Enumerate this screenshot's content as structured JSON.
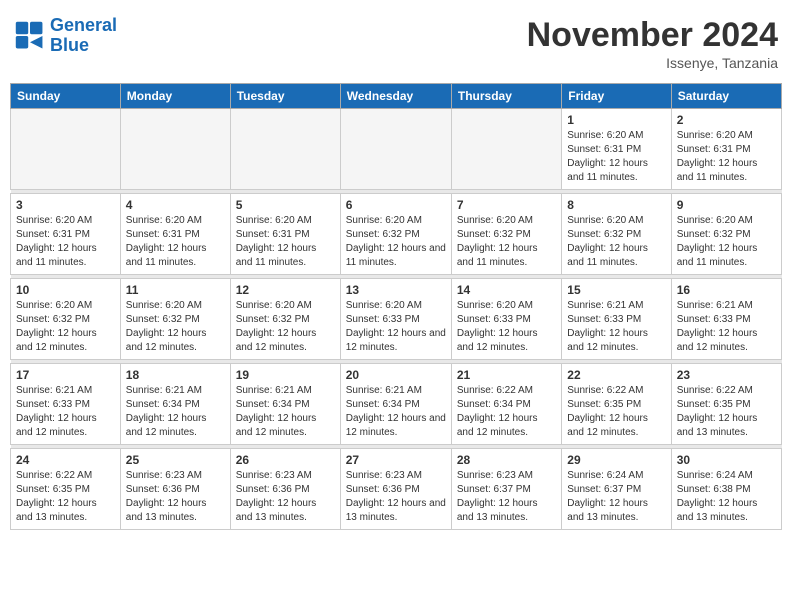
{
  "header": {
    "logo_line1": "General",
    "logo_line2": "Blue",
    "month": "November 2024",
    "location": "Issenye, Tanzania"
  },
  "weekdays": [
    "Sunday",
    "Monday",
    "Tuesday",
    "Wednesday",
    "Thursday",
    "Friday",
    "Saturday"
  ],
  "weeks": [
    [
      {
        "day": "",
        "info": ""
      },
      {
        "day": "",
        "info": ""
      },
      {
        "day": "",
        "info": ""
      },
      {
        "day": "",
        "info": ""
      },
      {
        "day": "",
        "info": ""
      },
      {
        "day": "1",
        "info": "Sunrise: 6:20 AM\nSunset: 6:31 PM\nDaylight: 12 hours\nand 11 minutes."
      },
      {
        "day": "2",
        "info": "Sunrise: 6:20 AM\nSunset: 6:31 PM\nDaylight: 12 hours\nand 11 minutes."
      }
    ],
    [
      {
        "day": "3",
        "info": "Sunrise: 6:20 AM\nSunset: 6:31 PM\nDaylight: 12 hours\nand 11 minutes."
      },
      {
        "day": "4",
        "info": "Sunrise: 6:20 AM\nSunset: 6:31 PM\nDaylight: 12 hours\nand 11 minutes."
      },
      {
        "day": "5",
        "info": "Sunrise: 6:20 AM\nSunset: 6:31 PM\nDaylight: 12 hours\nand 11 minutes."
      },
      {
        "day": "6",
        "info": "Sunrise: 6:20 AM\nSunset: 6:32 PM\nDaylight: 12 hours\nand 11 minutes."
      },
      {
        "day": "7",
        "info": "Sunrise: 6:20 AM\nSunset: 6:32 PM\nDaylight: 12 hours\nand 11 minutes."
      },
      {
        "day": "8",
        "info": "Sunrise: 6:20 AM\nSunset: 6:32 PM\nDaylight: 12 hours\nand 11 minutes."
      },
      {
        "day": "9",
        "info": "Sunrise: 6:20 AM\nSunset: 6:32 PM\nDaylight: 12 hours\nand 11 minutes."
      }
    ],
    [
      {
        "day": "10",
        "info": "Sunrise: 6:20 AM\nSunset: 6:32 PM\nDaylight: 12 hours\nand 12 minutes."
      },
      {
        "day": "11",
        "info": "Sunrise: 6:20 AM\nSunset: 6:32 PM\nDaylight: 12 hours\nand 12 minutes."
      },
      {
        "day": "12",
        "info": "Sunrise: 6:20 AM\nSunset: 6:32 PM\nDaylight: 12 hours\nand 12 minutes."
      },
      {
        "day": "13",
        "info": "Sunrise: 6:20 AM\nSunset: 6:33 PM\nDaylight: 12 hours\nand 12 minutes."
      },
      {
        "day": "14",
        "info": "Sunrise: 6:20 AM\nSunset: 6:33 PM\nDaylight: 12 hours\nand 12 minutes."
      },
      {
        "day": "15",
        "info": "Sunrise: 6:21 AM\nSunset: 6:33 PM\nDaylight: 12 hours\nand 12 minutes."
      },
      {
        "day": "16",
        "info": "Sunrise: 6:21 AM\nSunset: 6:33 PM\nDaylight: 12 hours\nand 12 minutes."
      }
    ],
    [
      {
        "day": "17",
        "info": "Sunrise: 6:21 AM\nSunset: 6:33 PM\nDaylight: 12 hours\nand 12 minutes."
      },
      {
        "day": "18",
        "info": "Sunrise: 6:21 AM\nSunset: 6:34 PM\nDaylight: 12 hours\nand 12 minutes."
      },
      {
        "day": "19",
        "info": "Sunrise: 6:21 AM\nSunset: 6:34 PM\nDaylight: 12 hours\nand 12 minutes."
      },
      {
        "day": "20",
        "info": "Sunrise: 6:21 AM\nSunset: 6:34 PM\nDaylight: 12 hours\nand 12 minutes."
      },
      {
        "day": "21",
        "info": "Sunrise: 6:22 AM\nSunset: 6:34 PM\nDaylight: 12 hours\nand 12 minutes."
      },
      {
        "day": "22",
        "info": "Sunrise: 6:22 AM\nSunset: 6:35 PM\nDaylight: 12 hours\nand 12 minutes."
      },
      {
        "day": "23",
        "info": "Sunrise: 6:22 AM\nSunset: 6:35 PM\nDaylight: 12 hours\nand 13 minutes."
      }
    ],
    [
      {
        "day": "24",
        "info": "Sunrise: 6:22 AM\nSunset: 6:35 PM\nDaylight: 12 hours\nand 13 minutes."
      },
      {
        "day": "25",
        "info": "Sunrise: 6:23 AM\nSunset: 6:36 PM\nDaylight: 12 hours\nand 13 minutes."
      },
      {
        "day": "26",
        "info": "Sunrise: 6:23 AM\nSunset: 6:36 PM\nDaylight: 12 hours\nand 13 minutes."
      },
      {
        "day": "27",
        "info": "Sunrise: 6:23 AM\nSunset: 6:36 PM\nDaylight: 12 hours\nand 13 minutes."
      },
      {
        "day": "28",
        "info": "Sunrise: 6:23 AM\nSunset: 6:37 PM\nDaylight: 12 hours\nand 13 minutes."
      },
      {
        "day": "29",
        "info": "Sunrise: 6:24 AM\nSunset: 6:37 PM\nDaylight: 12 hours\nand 13 minutes."
      },
      {
        "day": "30",
        "info": "Sunrise: 6:24 AM\nSunset: 6:38 PM\nDaylight: 12 hours\nand 13 minutes."
      }
    ]
  ]
}
